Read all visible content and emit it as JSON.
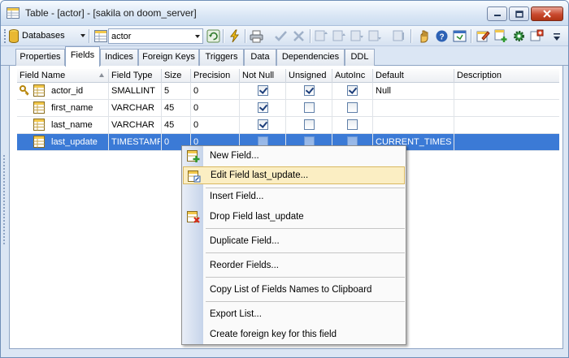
{
  "window": {
    "title": "Table - [actor] - [sakila on doom_server]"
  },
  "toolbar": {
    "databases_label": "Databases",
    "table_combo_value": "actor"
  },
  "tabs": [
    {
      "label": "Properties",
      "active": false
    },
    {
      "label": "Fields",
      "active": true
    },
    {
      "label": "Indices",
      "active": false
    },
    {
      "label": "Foreign Keys",
      "active": false
    },
    {
      "label": "Triggers",
      "active": false
    },
    {
      "label": "Data",
      "active": false
    },
    {
      "label": "Dependencies",
      "active": false
    },
    {
      "label": "DDL",
      "active": false
    }
  ],
  "grid": {
    "columns": [
      "Field Name",
      "Field Type",
      "Size",
      "Precision",
      "Not Null",
      "Unsigned",
      "AutoInc",
      "Default",
      "Description"
    ],
    "rows": [
      {
        "name": "actor_id",
        "type": "SMALLINT",
        "size": "5",
        "precision": "0",
        "not_null": true,
        "unsigned": true,
        "autoinc": true,
        "default": "Null",
        "description": "",
        "primary_key": true,
        "selected": false
      },
      {
        "name": "first_name",
        "type": "VARCHAR",
        "size": "45",
        "precision": "0",
        "not_null": true,
        "unsigned": false,
        "autoinc": false,
        "default": "",
        "description": "",
        "primary_key": false,
        "selected": false
      },
      {
        "name": "last_name",
        "type": "VARCHAR",
        "size": "45",
        "precision": "0",
        "not_null": true,
        "unsigned": false,
        "autoinc": false,
        "default": "",
        "description": "",
        "primary_key": false,
        "selected": false
      },
      {
        "name": "last_update",
        "type": "TIMESTAMP",
        "size": "0",
        "precision": "0",
        "not_null": false,
        "unsigned": false,
        "autoinc": false,
        "default": "CURRENT_TIMES",
        "description": "",
        "primary_key": false,
        "selected": true
      }
    ]
  },
  "context_menu": {
    "items": [
      {
        "label": "New Field...",
        "icon": "new-field-icon",
        "highlighted": false
      },
      {
        "label": "Edit Field last_update...",
        "icon": "edit-field-icon",
        "highlighted": true
      },
      {
        "label": "Insert Field...",
        "icon": "",
        "highlighted": false
      },
      {
        "label": "Drop Field last_update",
        "icon": "drop-field-icon",
        "highlighted": false
      },
      {
        "label": "Duplicate Field...",
        "icon": "",
        "highlighted": false
      },
      {
        "label": "Reorder Fields...",
        "icon": "",
        "highlighted": false
      },
      {
        "label": "Copy List of Fields Names to Clipboard",
        "icon": "",
        "highlighted": false
      },
      {
        "label": "Export List...",
        "icon": "",
        "highlighted": false
      },
      {
        "label": "Create foreign key for this field",
        "icon": "",
        "highlighted": false
      }
    ]
  },
  "colors": {
    "selection": "#3b7ad6",
    "menu_highlight": "#fbeec3",
    "window_frame": "#dbe6f4"
  }
}
